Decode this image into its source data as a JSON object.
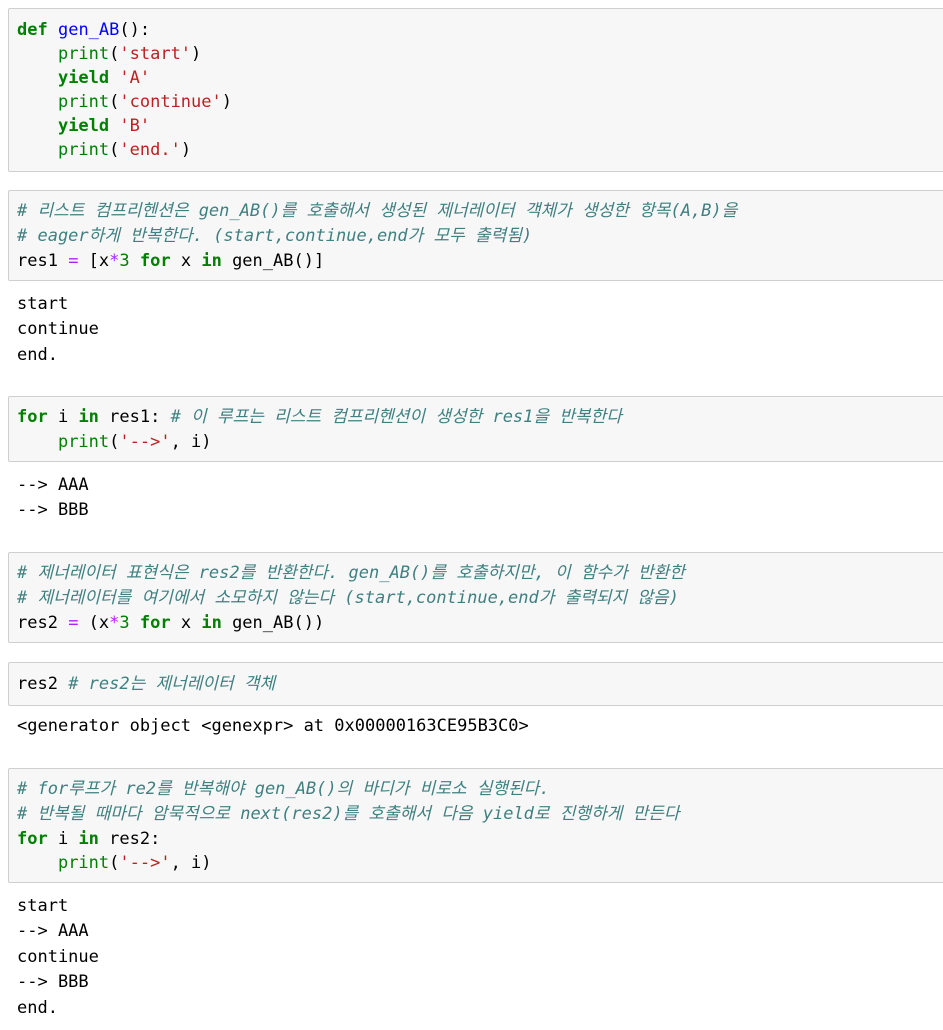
{
  "cells": [
    {
      "type": "code",
      "lines": [
        [
          {
            "t": "def",
            "c": "kw"
          },
          {
            "t": " "
          },
          {
            "t": "gen_AB",
            "c": "fn"
          },
          {
            "t": "():"
          }
        ],
        [
          {
            "t": "    "
          },
          {
            "t": "print",
            "c": "bi"
          },
          {
            "t": "("
          },
          {
            "t": "'start'",
            "c": "str"
          },
          {
            "t": ")"
          }
        ],
        [
          {
            "t": "    "
          },
          {
            "t": "yield",
            "c": "kw"
          },
          {
            "t": " "
          },
          {
            "t": "'A'",
            "c": "str"
          }
        ],
        [
          {
            "t": "    "
          },
          {
            "t": "print",
            "c": "bi"
          },
          {
            "t": "("
          },
          {
            "t": "'continue'",
            "c": "str"
          },
          {
            "t": ")"
          }
        ],
        [
          {
            "t": "    "
          },
          {
            "t": "yield",
            "c": "kw"
          },
          {
            "t": " "
          },
          {
            "t": "'B'",
            "c": "str"
          }
        ],
        [
          {
            "t": "    "
          },
          {
            "t": "print",
            "c": "bi"
          },
          {
            "t": "("
          },
          {
            "t": "'end.'",
            "c": "str"
          },
          {
            "t": ")"
          }
        ]
      ]
    },
    {
      "type": "code",
      "lines": [
        [
          {
            "t": "# 리스트 컴프리헨션은 gen_AB()를 호출해서 생성된 제너레이터 객체가 생성한 항목(A,B)을",
            "c": "cm"
          }
        ],
        [
          {
            "t": "# eager하게 반복한다. (start,continue,end가 모두 출력됨)",
            "c": "cm"
          }
        ],
        [
          {
            "t": "res1 "
          },
          {
            "t": "=",
            "c": "op"
          },
          {
            "t": " [x"
          },
          {
            "t": "*",
            "c": "op"
          },
          {
            "t": "3",
            "c": "num"
          },
          {
            "t": " "
          },
          {
            "t": "for",
            "c": "kw"
          },
          {
            "t": " x "
          },
          {
            "t": "in",
            "c": "kw"
          },
          {
            "t": " gen_AB()]"
          }
        ]
      ]
    },
    {
      "type": "output",
      "lines": [
        "start",
        "continue",
        "end."
      ]
    },
    {
      "type": "code",
      "lines": [
        [
          {
            "t": "for",
            "c": "kw"
          },
          {
            "t": " i "
          },
          {
            "t": "in",
            "c": "kw"
          },
          {
            "t": " res1: "
          },
          {
            "t": "# 이 루프는 리스트 컴프리헨션이 생성한 res1을 반복한다",
            "c": "cm"
          }
        ],
        [
          {
            "t": "    "
          },
          {
            "t": "print",
            "c": "bi"
          },
          {
            "t": "("
          },
          {
            "t": "'-->'",
            "c": "str"
          },
          {
            "t": ", i)"
          }
        ]
      ]
    },
    {
      "type": "output",
      "lines": [
        "--> AAA",
        "--> BBB"
      ]
    },
    {
      "type": "code",
      "lines": [
        [
          {
            "t": "# 제너레이터 표현식은 res2를 반환한다. gen_AB()를 호출하지만, 이 함수가 반환한",
            "c": "cm"
          }
        ],
        [
          {
            "t": "# 제너레이터를 여기에서 소모하지 않는다 (start,continue,end가 출력되지 않음)",
            "c": "cm"
          }
        ],
        [
          {
            "t": "res2 "
          },
          {
            "t": "=",
            "c": "op"
          },
          {
            "t": " (x"
          },
          {
            "t": "*",
            "c": "op"
          },
          {
            "t": "3",
            "c": "num"
          },
          {
            "t": " "
          },
          {
            "t": "for",
            "c": "kw"
          },
          {
            "t": " x "
          },
          {
            "t": "in",
            "c": "kw"
          },
          {
            "t": " gen_AB())"
          }
        ]
      ]
    },
    {
      "type": "code",
      "lines": [
        [
          {
            "t": "res2 "
          },
          {
            "t": "# res2는 제너레이터 객체",
            "c": "cm"
          }
        ]
      ]
    },
    {
      "type": "output",
      "lines": [
        "<generator object <genexpr> at 0x00000163CE95B3C0>"
      ]
    },
    {
      "type": "code",
      "lines": [
        [
          {
            "t": "# for루프가 re2를 반복해야 gen_AB()의 바디가 비로소 실행된다.",
            "c": "cm"
          }
        ],
        [
          {
            "t": "# 반복될 때마다 암묵적으로 next(res2)를 호출해서 다음 yield로 진행하게 만든다",
            "c": "cm"
          }
        ],
        [
          {
            "t": "for",
            "c": "kw"
          },
          {
            "t": " i "
          },
          {
            "t": "in",
            "c": "kw"
          },
          {
            "t": " res2:"
          }
        ],
        [
          {
            "t": "    "
          },
          {
            "t": "print",
            "c": "bi"
          },
          {
            "t": "("
          },
          {
            "t": "'-->'",
            "c": "str"
          },
          {
            "t": ", i)"
          }
        ]
      ]
    },
    {
      "type": "output",
      "lines": [
        "start",
        "--> AAA",
        "continue",
        "--> BBB",
        "end."
      ]
    }
  ]
}
